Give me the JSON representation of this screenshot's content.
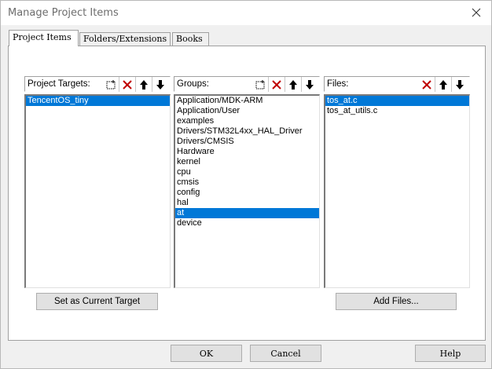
{
  "window": {
    "title": "Manage Project Items"
  },
  "tabs": [
    {
      "label": "Project Items",
      "active": true
    },
    {
      "label": "Folders/Extensions",
      "active": false
    },
    {
      "label": "Books",
      "active": false
    }
  ],
  "targets_panel": {
    "label": "Project Targets:",
    "items": [
      "TencentOS_tiny"
    ],
    "selected_index": 0,
    "button_label": "Set as Current Target"
  },
  "groups_panel": {
    "label": "Groups:",
    "items": [
      "Application/MDK-ARM",
      "Application/User",
      "examples",
      "Drivers/STM32L4xx_HAL_Driver",
      "Drivers/CMSIS",
      "Hardware",
      "kernel",
      "cpu",
      "cmsis",
      "config",
      "hal",
      "at",
      "device"
    ],
    "selected_index": 11
  },
  "files_panel": {
    "label": "Files:",
    "items": [
      "tos_at.c",
      "tos_at_utils.c"
    ],
    "selected_index": 0,
    "button_label": "Add Files..."
  },
  "dialog_buttons": {
    "ok": "OK",
    "cancel": "Cancel",
    "help": "Help"
  },
  "icons": {
    "new": "new-item-icon",
    "delete": "delete-icon",
    "up": "move-up-icon",
    "down": "move-down-icon",
    "close": "close-icon"
  },
  "colors": {
    "selection": "#0078d7",
    "delete_red": "#c00000"
  }
}
